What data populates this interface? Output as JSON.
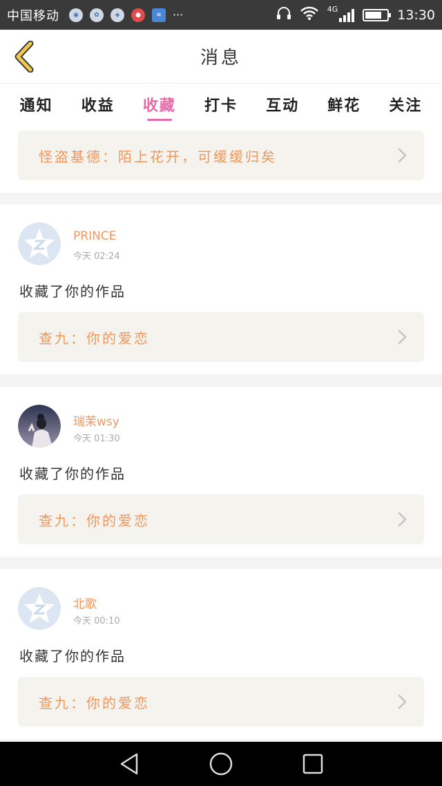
{
  "status_bar": {
    "carrier": "中国移动",
    "network": "4G",
    "time": "13:30",
    "battery_level": 0.75,
    "notification_icons": [
      "app-icon",
      "app-icon",
      "app-icon",
      "red-app-icon",
      "wifi-app-icon"
    ]
  },
  "header": {
    "title": "消息",
    "accent_color": "#f2c94c"
  },
  "tabs": [
    {
      "label": "通知",
      "active": false
    },
    {
      "label": "收益",
      "active": false
    },
    {
      "label": "收藏",
      "active": true
    },
    {
      "label": "打卡",
      "active": false
    },
    {
      "label": "互动",
      "active": false
    },
    {
      "label": "鲜花",
      "active": false
    },
    {
      "label": "关注",
      "active": false
    }
  ],
  "pinned": {
    "work_title": "怪盗基德：陌上花开，可缓缓归矣"
  },
  "cards": [
    {
      "username": "PRINCE",
      "time": "今天 02:24",
      "action": "收藏了你的作品",
      "work_title": "查九：你的爱恋",
      "avatar": "default-qq-avatar"
    },
    {
      "username": "瑞茉wsy",
      "time": "今天 01:30",
      "action": "收藏了你的作品",
      "work_title": "查九：你的爱恋",
      "avatar": "photo-avatar"
    },
    {
      "username": "北歌",
      "time": "今天 00:10",
      "action": "收藏了你的作品",
      "work_title": "查九：你的爱恋",
      "avatar": "default-qq-avatar"
    }
  ],
  "colors": {
    "accent_pink": "#e96aa8",
    "orange_text": "#f2965a",
    "card_box_bg": "#f4f3ee"
  },
  "nav_bar": {
    "buttons": [
      "back-triangle-icon",
      "home-circle-icon",
      "recents-square-icon"
    ]
  }
}
